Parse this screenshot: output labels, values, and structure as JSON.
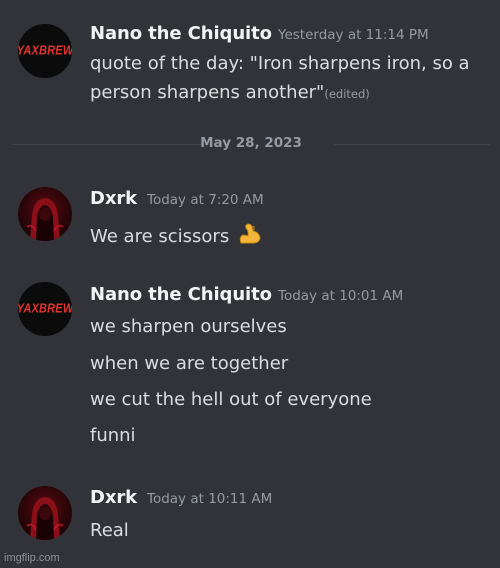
{
  "messages": [
    {
      "author": "Nano the Chiquito",
      "avatar_text": "YAXBREW",
      "timestamp": "Yesterday at 11:14 PM",
      "lines": [
        "quote of the day: \"Iron sharpens iron, so a",
        "person sharpens another\""
      ],
      "edited_label": "(edited)"
    },
    {
      "author": "Dxrk",
      "timestamp": "Today at 7:20 AM",
      "lines": [
        "We are scissors"
      ],
      "emoji": "flexed-biceps-icon"
    },
    {
      "author": "Nano the Chiquito",
      "avatar_text": "YAXBREW",
      "timestamp": "Today at 10:01 AM",
      "lines": [
        "we sharpen ourselves",
        "when we are together",
        "we cut the hell out of everyone",
        "funni"
      ]
    },
    {
      "author": "Dxrk",
      "timestamp": "Today at 10:11 AM",
      "lines": [
        "Real"
      ]
    }
  ],
  "date_divider": "May 28, 2023",
  "watermark": "imgflip.com",
  "colors": {
    "background": "#313338",
    "username": "#f2f3f5",
    "text": "#dbdee1",
    "muted": "#949ba4",
    "avatar_red": "#e0342f"
  }
}
